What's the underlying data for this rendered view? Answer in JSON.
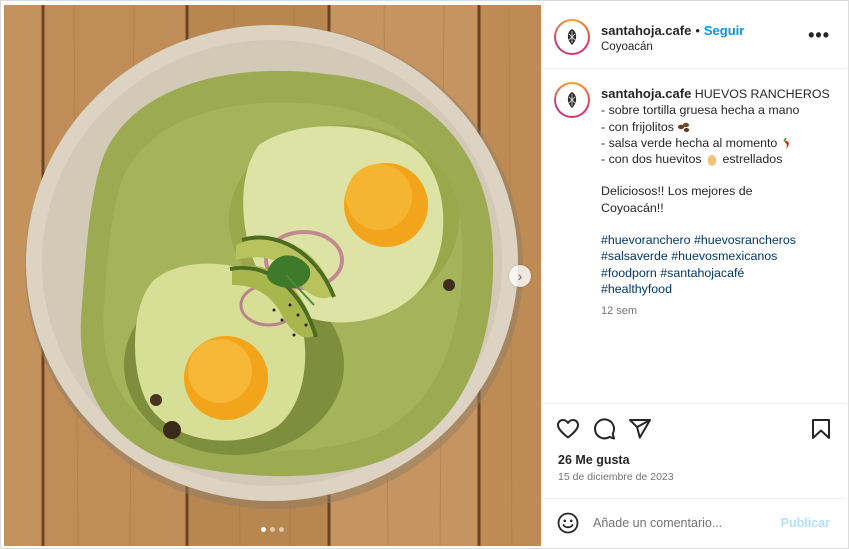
{
  "header": {
    "username": "santahoja.cafe",
    "separator": "•",
    "follow_label": "Seguir",
    "location": "Coyoacán",
    "more_icon": "more-options-icon",
    "more_glyph": "•••"
  },
  "caption": {
    "username": "santahoja.cafe",
    "title": "HUEVOS RANCHEROS",
    "lines": [
      "- sobre tortilla gruesa hecha a mano",
      "- con frijolitos",
      "- salsa verde hecha al momento",
      "- con dos huevitos",
      "estrellados"
    ],
    "comment_line1": "Deliciosos!! Los mejores de",
    "comment_line2": "Coyoacán!!",
    "hashtags": [
      "#huevoranchero",
      "#huevosrancheros",
      "#salsaverde",
      "#huevosmexicanos",
      "#foodporn",
      "#santahojacafé",
      "#healthyfood"
    ],
    "time_ago": "12 sem"
  },
  "actions": {
    "likes": "26 Me gusta",
    "date": "15 de diciembre de 2023",
    "icons": [
      "heart-icon",
      "comment-icon",
      "share-icon",
      "bookmark-icon"
    ]
  },
  "comment": {
    "placeholder": "Añade un comentario...",
    "publish_label": "Publicar"
  },
  "media": {
    "carousel_total": 3,
    "carousel_active": 1,
    "next_glyph": "›"
  },
  "colors": {
    "link": "#0095f6",
    "hashtag": "#00376b",
    "muted": "#737373",
    "publish_disabled": "#b2dffc"
  }
}
